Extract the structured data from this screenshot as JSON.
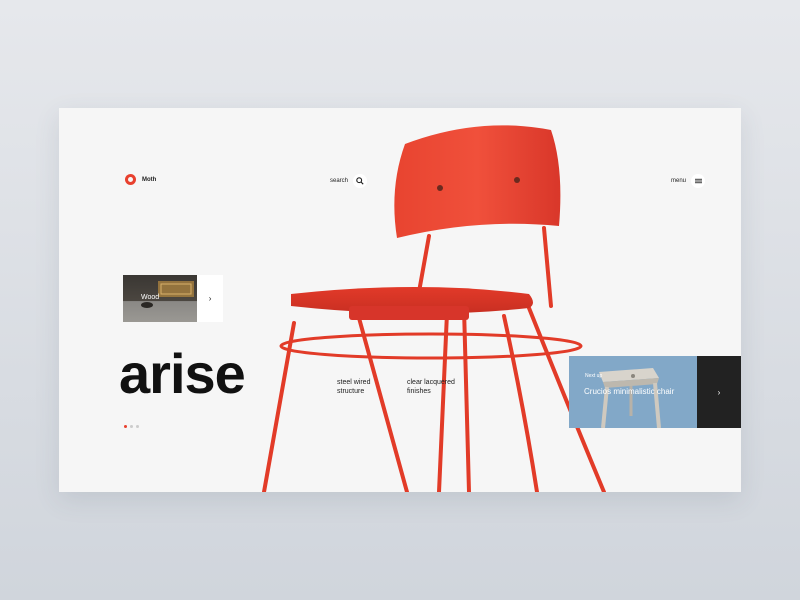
{
  "header": {
    "logo_text": "Moth",
    "search_label": "search",
    "menu_label": "menu"
  },
  "hero": {
    "title": "arise",
    "features": [
      "steel wired structure",
      "clear lacquered finishes"
    ]
  },
  "side_card": {
    "label": "Wood",
    "arrow_icon": "chevron-right-icon"
  },
  "product_card": {
    "tag": "Next up",
    "name": "Crucios minimalistic chair",
    "arrow_icon": "chevron-right-icon"
  },
  "pagination": {
    "total": 3,
    "active": 1
  },
  "colors": {
    "accent": "#e8402e",
    "chair": "#ea3d2b",
    "dark": "#111111",
    "product_bg": "#82a8c8"
  },
  "icons": {
    "logo": "logo-mark-icon",
    "search": "search-icon",
    "menu": "hamburger-menu-icon"
  }
}
